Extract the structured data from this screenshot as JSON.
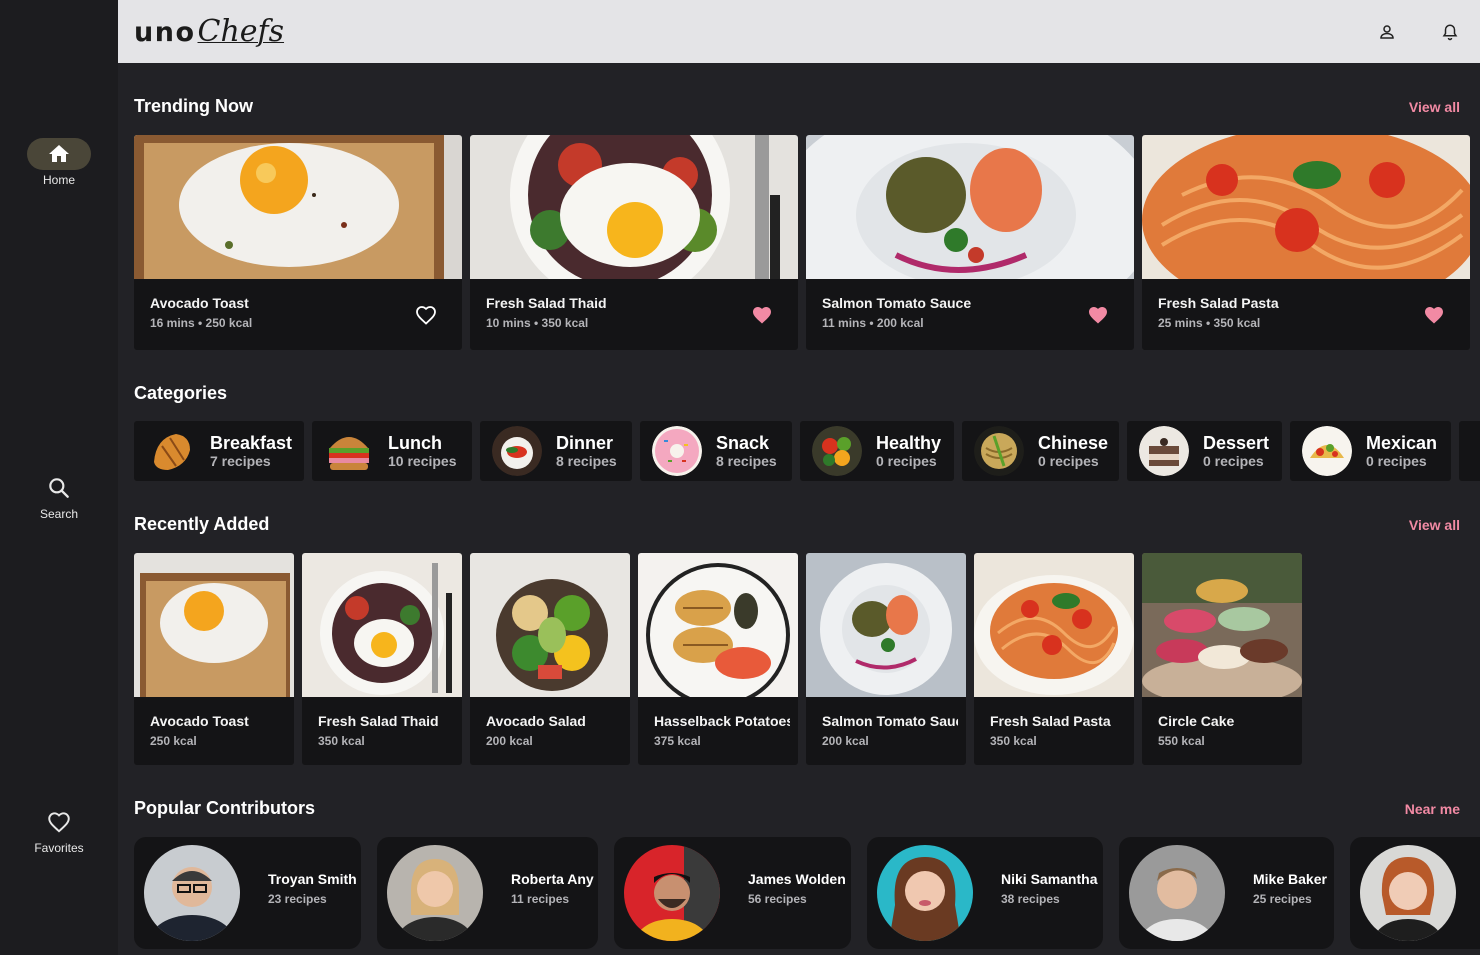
{
  "app": {
    "brand_prefix": "uno",
    "brand_suffix": "Chefs",
    "colors": {
      "accent": "#f28aa4",
      "background": "#222226",
      "card": "#141416",
      "rail": "#1c1c1f",
      "topbar": "#e4e4e7"
    }
  },
  "nav": [
    {
      "label": "Home",
      "icon": "home-icon",
      "active": true
    },
    {
      "label": "Search",
      "icon": "search-icon",
      "active": false
    },
    {
      "label": "Favorites",
      "icon": "heart-icon",
      "active": false
    }
  ],
  "topbar_icons": [
    "account-icon",
    "bell-icon"
  ],
  "trending": {
    "title": "Trending Now",
    "link": "View all",
    "items": [
      {
        "name": "Avocado Toast",
        "meta": "16 mins • 250 kcal",
        "favorite": false
      },
      {
        "name": "Fresh Salad Thaid",
        "meta": "10 mins • 350 kcal",
        "favorite": true
      },
      {
        "name": "Salmon Tomato Sauce",
        "meta": "11 mins • 200 kcal",
        "favorite": true
      },
      {
        "name": "Fresh Salad Pasta",
        "meta": "25 mins • 350 kcal",
        "favorite": true
      }
    ]
  },
  "categories": {
    "title": "Categories",
    "items": [
      {
        "name": "Breakfast",
        "count": "7 recipes"
      },
      {
        "name": "Lunch",
        "count": "10 recipes"
      },
      {
        "name": "Dinner",
        "count": "8 recipes"
      },
      {
        "name": "Snack",
        "count": "8 recipes"
      },
      {
        "name": "Healthy",
        "count": "0 recipes"
      },
      {
        "name": "Chinese",
        "count": "0 recipes"
      },
      {
        "name": "Dessert",
        "count": "0 recipes"
      },
      {
        "name": "Mexican",
        "count": "0 recipes"
      }
    ]
  },
  "recent": {
    "title": "Recently Added",
    "link": "View all",
    "items": [
      {
        "name": "Avocado Toast",
        "kcal": "250 kcal"
      },
      {
        "name": "Fresh Salad Thaid",
        "kcal": "350 kcal"
      },
      {
        "name": "Avocado Salad",
        "kcal": "200 kcal"
      },
      {
        "name": "Hasselback Potatoes",
        "kcal": "375 kcal"
      },
      {
        "name": "Salmon Tomato Sauce",
        "kcal": "200 kcal"
      },
      {
        "name": "Fresh Salad Pasta",
        "kcal": "350 kcal"
      },
      {
        "name": "Circle Cake",
        "kcal": "550 kcal"
      }
    ]
  },
  "contributors": {
    "title": "Popular Contributors",
    "link": "Near me",
    "items": [
      {
        "name": "Troyan Smith",
        "count": "23 recipes"
      },
      {
        "name": "Roberta Any",
        "count": "11 recipes"
      },
      {
        "name": "James Wolden",
        "count": "56 recipes"
      },
      {
        "name": "Niki Samantha",
        "count": "38 recipes"
      },
      {
        "name": "Mike Baker",
        "count": "25 recipes"
      }
    ]
  }
}
